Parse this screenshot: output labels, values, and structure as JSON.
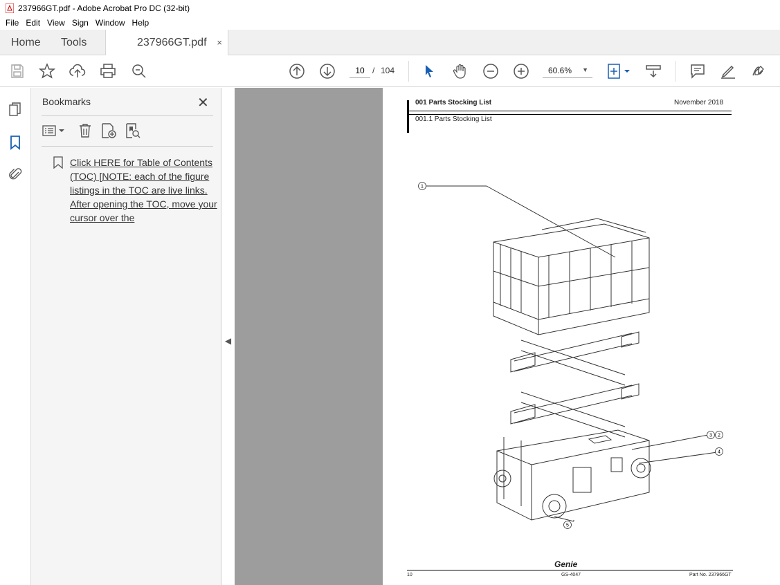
{
  "window": {
    "title": "237966GT.pdf - Adobe Acrobat Pro DC (32-bit)"
  },
  "menu": [
    "File",
    "Edit",
    "View",
    "Sign",
    "Window",
    "Help"
  ],
  "tabs": {
    "home": "Home",
    "tools": "Tools",
    "doc": "237966GT.pdf",
    "close": "×"
  },
  "toolbar": {
    "page_current": "10",
    "page_sep": "/",
    "page_total": "104",
    "zoom": "60.6%",
    "icons": [
      "save-icon",
      "star-icon",
      "upload-icon",
      "print-icon",
      "search-icon",
      "page-up-icon",
      "page-down-icon",
      "select-cursor-icon",
      "hand-icon",
      "zoom-out-icon",
      "zoom-in-icon",
      "fit-page-icon",
      "scroll-mode-icon",
      "comment-icon",
      "highlight-icon",
      "sign-icon"
    ]
  },
  "bookmarks": {
    "title": "Bookmarks",
    "close": "✕",
    "item": "Click HERE for Table of Contents (TOC) [NOTE: each of the figure listings in the TOC are live links. After opening the TOC, move your cursor over the"
  },
  "page": {
    "header_title": "001 Parts Stocking List",
    "header_date": "November 2018",
    "header_sub": "001.1 Parts Stocking List",
    "callouts": [
      "1",
      "3",
      "2",
      "4",
      "5"
    ],
    "footer_page": "10",
    "footer_logo": "Genie",
    "footer_model": "GS-4047",
    "footer_part": "Part No. 237966GT"
  }
}
